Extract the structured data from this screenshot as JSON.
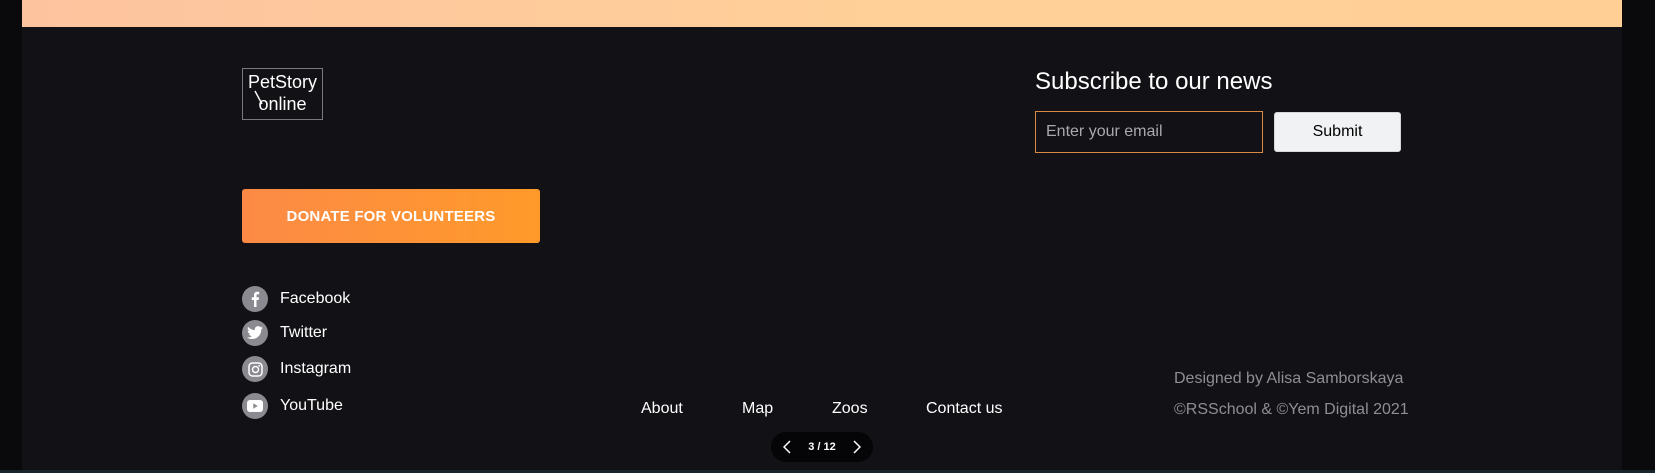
{
  "logo": {
    "line1": "PetStory",
    "line2": "online"
  },
  "donate": {
    "label": "DONATE FOR VOLUNTEERS"
  },
  "social": [
    {
      "label": "Facebook",
      "icon": "facebook-icon"
    },
    {
      "label": "Twitter",
      "icon": "twitter-icon"
    },
    {
      "label": "Instagram",
      "icon": "instagram-icon"
    },
    {
      "label": "YouTube",
      "icon": "youtube-icon"
    }
  ],
  "subscribe": {
    "title": "Subscribe to our news",
    "placeholder": "Enter your email",
    "submit_label": "Submit"
  },
  "nav": [
    "About",
    "Map",
    "Zoos",
    "Contact us"
  ],
  "credits": {
    "designed_by": "Designed by Alisa Samborskaya",
    "copyright": "©RSSchool & ©Yem Digital 2021"
  },
  "pager": {
    "count": "3 / 12"
  },
  "colors": {
    "top_strip": "#ffcf98",
    "footer_bg": "#121216",
    "donate_accent": "#fc8a46",
    "input_border": "#d98a45"
  }
}
